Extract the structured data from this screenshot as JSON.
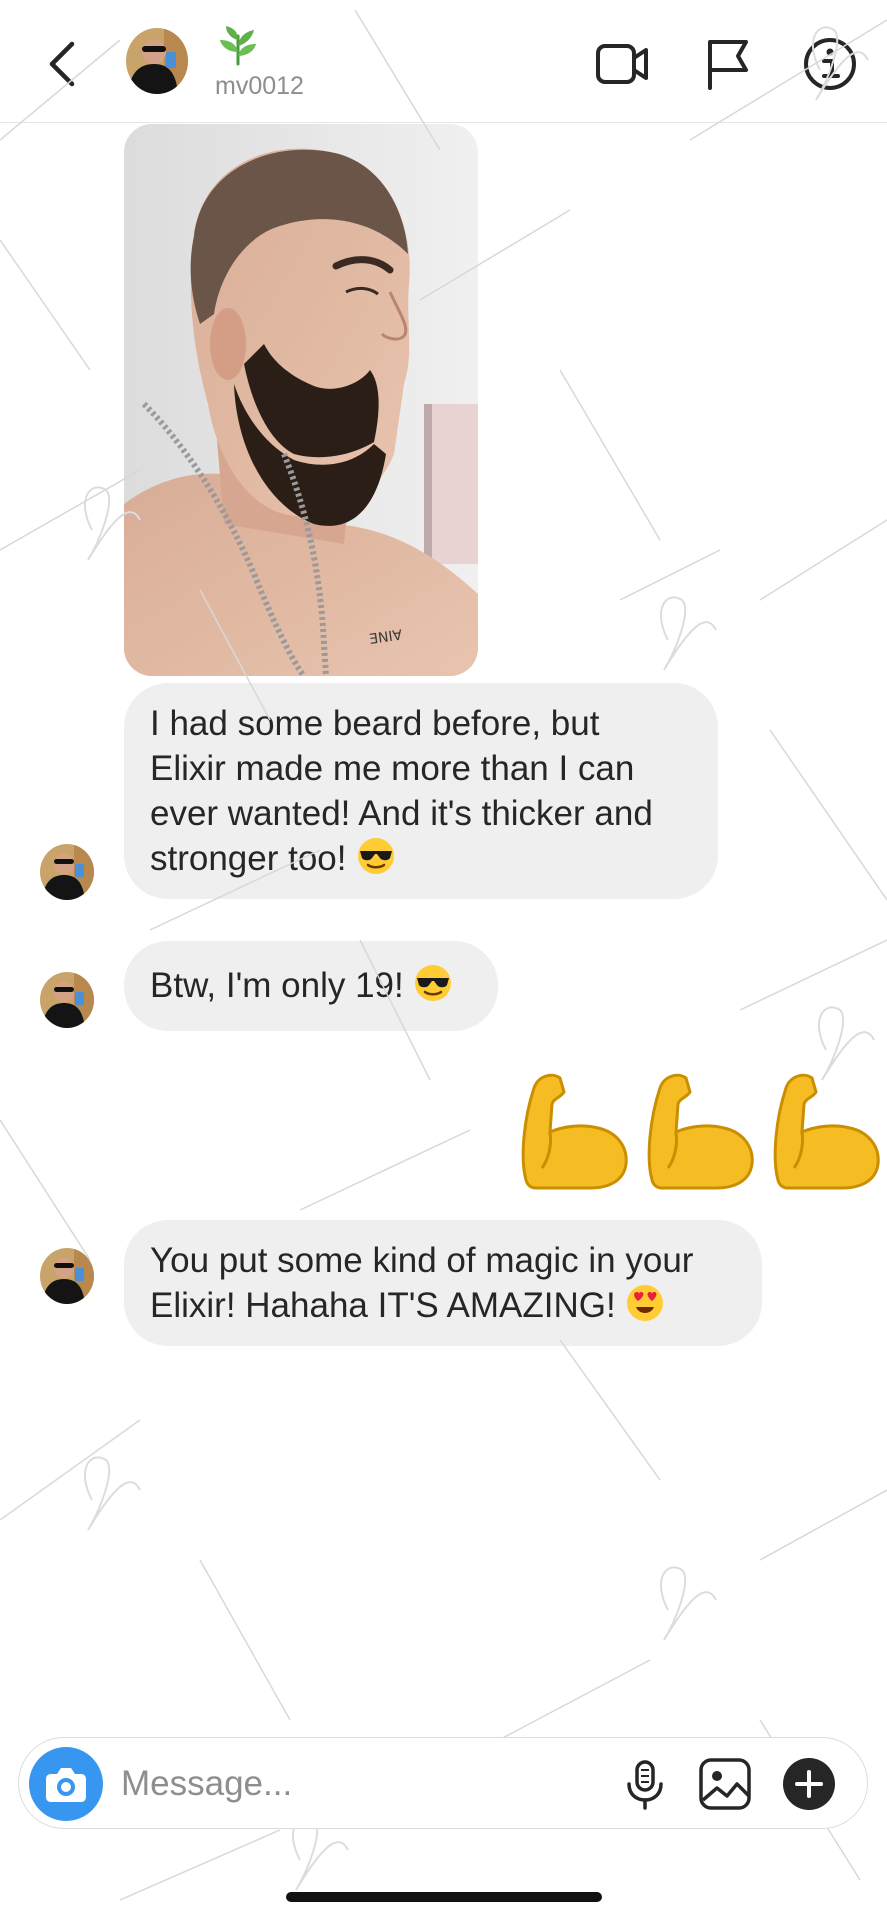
{
  "header": {
    "username": "mv0012",
    "icons": [
      "back-icon",
      "video-call-icon",
      "report-flag-icon",
      "info-icon"
    ]
  },
  "messages": [
    {
      "type": "photo",
      "caption_on_tattoo": "ƎNI∀"
    },
    {
      "type": "text",
      "text": "I had some beard before, but\nElixir made me more than I can\never wanted! And it's thicker and\nstronger too! ",
      "emoji": "sunglasses-emoji"
    },
    {
      "type": "text",
      "text": "Btw, I'm only 19! ",
      "emoji": "sunglasses-emoji"
    },
    {
      "type": "emoji-reply",
      "emoji": [
        "flexed-biceps-emoji",
        "flexed-biceps-emoji",
        "flexed-biceps-emoji"
      ]
    },
    {
      "type": "text",
      "text": "You put some kind of magic in your\nElixir! Hahaha IT'S AMAZING! ",
      "emoji": "heart-eyes-emoji"
    }
  ],
  "composer": {
    "placeholder": "Message...",
    "icons": [
      "camera-icon",
      "microphone-icon",
      "gallery-icon",
      "add-icon"
    ]
  },
  "colors": {
    "accent": "#3797f0",
    "bubble": "#efefef",
    "muted": "#8e8e8e"
  }
}
